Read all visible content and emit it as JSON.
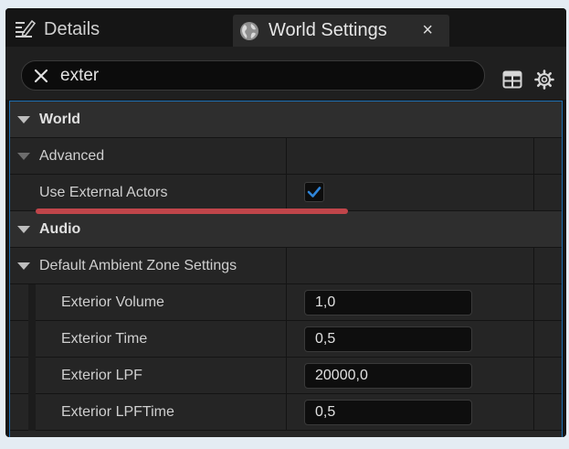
{
  "tabs": {
    "details_label": "Details",
    "world_settings_label": "World Settings",
    "close_glyph": "×"
  },
  "search": {
    "value": "exter"
  },
  "rows": {
    "world": "World",
    "advanced": "Advanced",
    "use_external_actors": "Use External Actors",
    "use_external_actors_checked": true,
    "audio": "Audio",
    "default_ambient_zone": "Default Ambient Zone Settings",
    "exterior_volume": {
      "label": "Exterior Volume",
      "value": "1,0"
    },
    "exterior_time": {
      "label": "Exterior Time",
      "value": "0,5"
    },
    "exterior_lpf": {
      "label": "Exterior LPF",
      "value": "20000,0"
    },
    "exterior_lpftime": {
      "label": "Exterior LPFTime",
      "value": "0,5"
    }
  },
  "icons": {
    "details": "pencil-list-icon",
    "world_settings": "globe-icon",
    "search_clear": "close-icon",
    "table_view": "table-icon",
    "settings": "gear-icon",
    "expand": "triangle-down-icon",
    "checkmark": "checkmark-icon"
  },
  "colors": {
    "selection_outline": "#1d6fb3",
    "check_color": "#2f84d8",
    "annotation_underline": "#c0454a"
  }
}
